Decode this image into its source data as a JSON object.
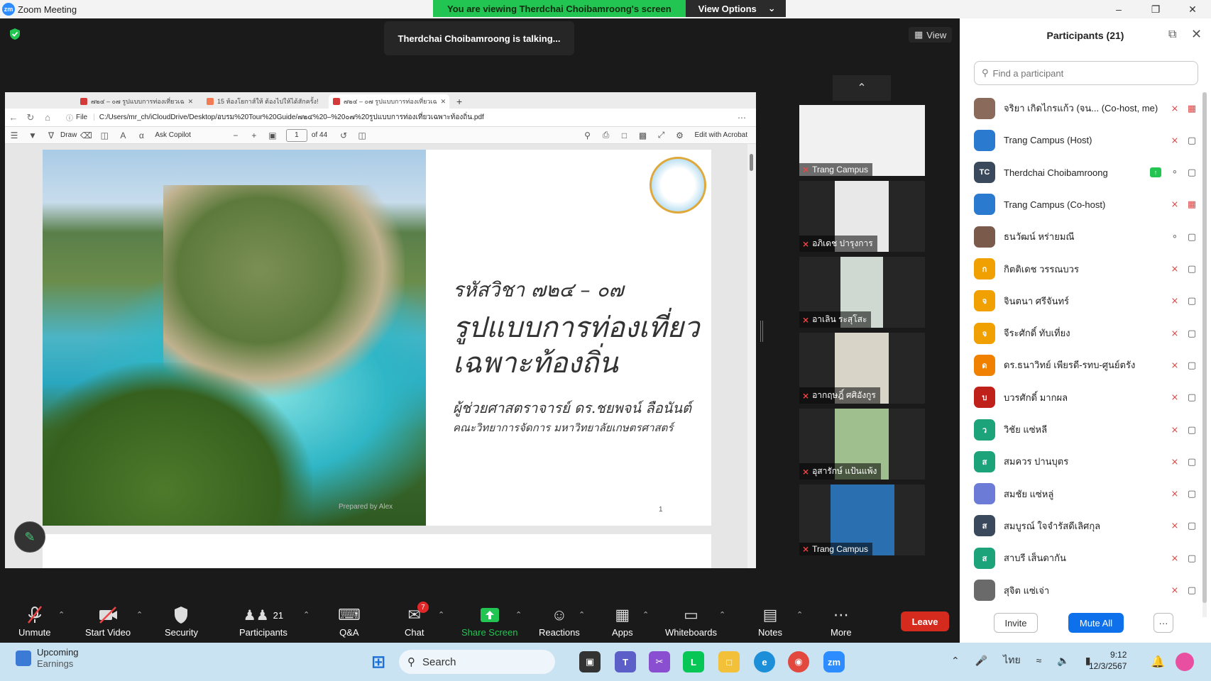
{
  "window": {
    "title": "Zoom Meeting",
    "logo": "zm"
  },
  "share_banner": {
    "message": "You are viewing Therdchai Choibamroong's screen",
    "view_options": "View Options"
  },
  "talking": "Therdchai Choibamroong is talking...",
  "view_button": "View",
  "browser": {
    "tabs": [
      {
        "label": "๗๒๔ – ๐๗ รูปแบบการท่องเที่ยวเฉ"
      },
      {
        "label": "15 ห้องโยกาส์ให้ ต้องไปให้ได้สักครั้ง!"
      },
      {
        "label": "๗๒๔ – ๐๗ รูปแบบการท่องเที่ยวเฉ"
      }
    ],
    "new_tab": "+",
    "file_label": "File",
    "url": "C:/Users/mr_ch/iCloudDrive/Desktop/อบรม%20Tour%20Guide/๗๒๔%20–%20๐๗%20รูปแบบการท่องเที่ยวเฉพาะท้องถิ่น.pdf",
    "pdf_toolbar": {
      "draw": "Draw",
      "ask_copilot": "Ask Copilot",
      "page": "1",
      "of_pages": "of 44",
      "edit_acrobat": "Edit with Acrobat"
    }
  },
  "slide": {
    "code": "รหัสวิชา ๗๒๔ – ๐๗",
    "title_line1": "รูปแบบการท่องเที่ยว",
    "title_line2": "เฉพาะท้องถิ่น",
    "author": "ผู้ช่วยศาสตราจารย์ ดร.ชยพจน์ ลือนันต์",
    "faculty": "คณะวิทยาการจัดการ มหาวิทยาลัยเกษตรศาสตร์",
    "prepared": "Prepared by Alex",
    "page_number": "1"
  },
  "gallery": [
    {
      "name": "Trang Campus",
      "bg": "#f1f1f1"
    },
    {
      "name": "อภิเดช ปารุงการ",
      "bg": "#e8e8e8"
    },
    {
      "name": "อาเลิน ระสุโสะ",
      "bg": "#cfd9d2"
    },
    {
      "name": "อากฤษฎิ์ ศศิอังกูร",
      "bg": "#d8d4c7"
    },
    {
      "name": "อุสารักษ์ แป้นแพ้ง",
      "bg": "#9fbf8f"
    },
    {
      "name": "Trang Campus",
      "bg": "#2a6fb0"
    }
  ],
  "participants": {
    "title": "Participants (21)",
    "search_placeholder": "Find a participant",
    "list": [
      {
        "name": "จริยา เกิดไกรแก้ว (จน... (Co-host, me)",
        "initial": "",
        "color": "#8a6b5b",
        "mic": "off",
        "cam": "off"
      },
      {
        "name": "Trang Campus (Host)",
        "initial": "",
        "color": "#2a7bd0",
        "mic": "off",
        "cam": "on"
      },
      {
        "name": "Therdchai Choibamroong",
        "initial": "TC",
        "color": "#3a4a5c",
        "mic": "on",
        "cam": "on",
        "sharing": true
      },
      {
        "name": "Trang Campus (Co-host)",
        "initial": "",
        "color": "#2a7bd0",
        "mic": "off",
        "cam": "off"
      },
      {
        "name": "ธนวัฒน์ หร่ายมณี",
        "initial": "",
        "color": "#7a5a4a",
        "mic": "on",
        "cam": "on"
      },
      {
        "name": "กิตติเดช วรรณบวร",
        "initial": "ก",
        "color": "#f0a000",
        "mic": "off",
        "cam": "on"
      },
      {
        "name": "จินตนา ศรีจันทร์",
        "initial": "จ",
        "color": "#f0a000",
        "mic": "off",
        "cam": "on"
      },
      {
        "name": "จีระศักดิ์ ทับเที่ยง",
        "initial": "จ",
        "color": "#f0a000",
        "mic": "off",
        "cam": "on"
      },
      {
        "name": "ดร.ธนาวิทย์ เพียรดี-รทบ-ศูนย์ตรัง",
        "initial": "ด",
        "color": "#f08000",
        "mic": "off",
        "cam": "on"
      },
      {
        "name": "บวรศักดิ์ มากผล",
        "initial": "บ",
        "color": "#c0201a",
        "mic": "off",
        "cam": "on"
      },
      {
        "name": "วิชัย แซ่หลี",
        "initial": "ว",
        "color": "#1ca37a",
        "mic": "off",
        "cam": "on"
      },
      {
        "name": "สมควร ปานบุตร",
        "initial": "ส",
        "color": "#1ca37a",
        "mic": "off",
        "cam": "on"
      },
      {
        "name": "สมชัย แซ่หลู่",
        "initial": "",
        "color": "#6b7bd6",
        "mic": "off",
        "cam": "on"
      },
      {
        "name": "สมบูรณ์ ใจจำรัสดีเลิศกุล",
        "initial": "ส",
        "color": "#3a4a5c",
        "mic": "off",
        "cam": "on"
      },
      {
        "name": "สาบรี เส็นดากัน",
        "initial": "ส",
        "color": "#1ca37a",
        "mic": "off",
        "cam": "on"
      },
      {
        "name": "สุจิต แซ่เจ่า",
        "initial": "",
        "color": "#6a6a6a",
        "mic": "off",
        "cam": "on"
      }
    ],
    "invite": "Invite",
    "mute_all": "Mute All",
    "more": "···"
  },
  "toolbar": {
    "unmute": "Unmute",
    "start_video": "Start Video",
    "security": "Security",
    "participants": "Participants",
    "participants_count": "21",
    "qa": "Q&A",
    "chat": "Chat",
    "chat_badge": "7",
    "share_screen": "Share Screen",
    "reactions": "Reactions",
    "apps": "Apps",
    "whiteboards": "Whiteboards",
    "notes": "Notes",
    "more": "More",
    "leave": "Leave"
  },
  "taskbar": {
    "weather_title": "Upcoming",
    "weather_sub": "Earnings",
    "search": "Search",
    "lang": "ไทย",
    "time": "9:12",
    "date": "12/3/2567"
  },
  "colors": {
    "zoom_blue": "#0e71eb",
    "share_green": "#23c552",
    "leave_red": "#d52b1e"
  }
}
